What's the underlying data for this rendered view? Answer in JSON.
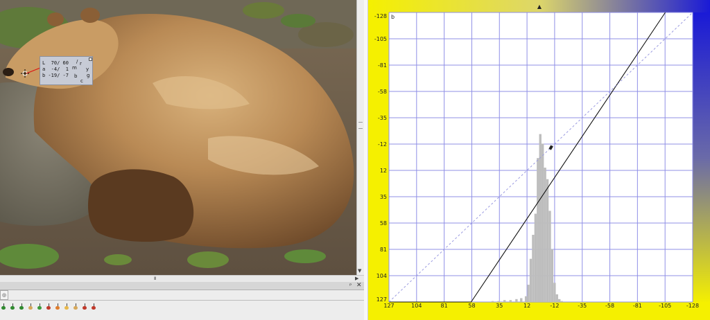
{
  "readout": {
    "row_l": "L  70/ 60",
    "row_a": "a  -4/  1",
    "row_b": "b -19/ -7",
    "wheel": {
      "top": "+",
      "r": "r",
      "m": "m",
      "y": "y",
      "b": "b",
      "g": "g",
      "c": "c",
      "l": "/"
    }
  },
  "image_pane": {
    "subject": "bear"
  },
  "scrollbar": {
    "h_grip": "III",
    "v_grip": "="
  },
  "bottom_panel": {
    "pin_icon": "pin-icon",
    "close_label": "✕",
    "tab_label": "◎",
    "swatch_colors": [
      "#2f8a2f",
      "#2f8a2f",
      "#2f8a2f",
      "#d6a85a",
      "#3c9a3c",
      "#c0392b",
      "#e07d2c",
      "#e8b84a",
      "#d6a85a",
      "#c0392b",
      "#c0392b"
    ]
  },
  "curve_panel": {
    "channel_label": "b",
    "top_marker": "▲",
    "left_ticks": [
      "-128",
      "-105",
      "-81",
      "-58",
      "-35",
      "-12",
      "12",
      "35",
      "58",
      "81",
      "104",
      "127"
    ],
    "bottom_ticks": [
      "127",
      "104",
      "81",
      "58",
      "35",
      "12",
      "-12",
      "-35",
      "-58",
      "-81",
      "-105",
      "-128"
    ],
    "gradient_colors": {
      "yellow": "#f5f000",
      "blue": "#1a1ad6"
    }
  },
  "chart_data": {
    "type": "line",
    "xlabel": "",
    "ylabel": "",
    "xlim": [
      127,
      -128
    ],
    "ylim": [
      127,
      -128
    ],
    "grid": true,
    "series": [
      {
        "points": [
          [
            127,
            127
          ],
          [
            58,
            127
          ],
          [
            -105,
            -128
          ]
        ]
      },
      {
        "points": [
          [
            127,
            127
          ],
          [
            -128,
            -128
          ]
        ]
      }
    ],
    "histogram": {
      "x": [
        40,
        35,
        30,
        25,
        20,
        16,
        12,
        10,
        8,
        6,
        4,
        2,
        0,
        -2,
        -4,
        -6,
        -8,
        -10,
        -12,
        -14,
        -16,
        -18
      ],
      "values": [
        1,
        1,
        2,
        2,
        3,
        4,
        6,
        18,
        45,
        70,
        92,
        150,
        175,
        165,
        140,
        128,
        95,
        55,
        20,
        8,
        3,
        1
      ]
    }
  }
}
